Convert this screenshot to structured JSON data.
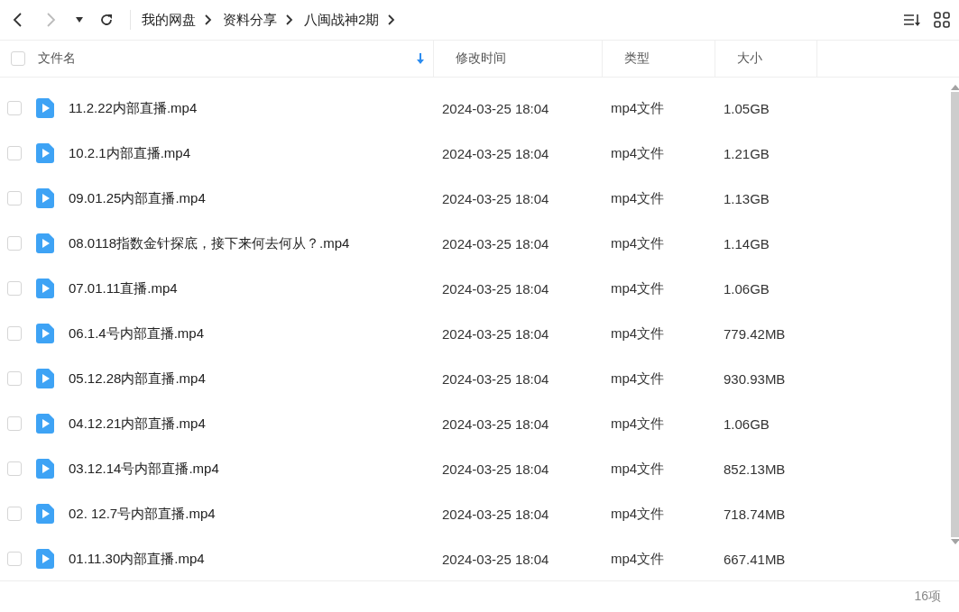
{
  "breadcrumb": [
    "我的网盘",
    "资料分享",
    "八闽战神2期"
  ],
  "table": {
    "columns": [
      "文件名",
      "修改时间",
      "类型",
      "大小"
    ],
    "all_checked": false,
    "rows": [
      {
        "name": "11.2.22内部直播.mp4",
        "modified": "2024-03-25 18:04",
        "type": "mp4文件",
        "size": "1.05GB",
        "checked": false
      },
      {
        "name": "10.2.1内部直播.mp4",
        "modified": "2024-03-25 18:04",
        "type": "mp4文件",
        "size": "1.21GB",
        "checked": false
      },
      {
        "name": "09.01.25内部直播.mp4",
        "modified": "2024-03-25 18:04",
        "type": "mp4文件",
        "size": "1.13GB",
        "checked": false
      },
      {
        "name": "08.0118指数金针探底，接下来何去何从？.mp4",
        "modified": "2024-03-25 18:04",
        "type": "mp4文件",
        "size": "1.14GB",
        "checked": false
      },
      {
        "name": "07.01.11直播.mp4",
        "modified": "2024-03-25 18:04",
        "type": "mp4文件",
        "size": "1.06GB",
        "checked": false
      },
      {
        "name": "06.1.4号内部直播.mp4",
        "modified": "2024-03-25 18:04",
        "type": "mp4文件",
        "size": "779.42MB",
        "checked": false
      },
      {
        "name": "05.12.28内部直播.mp4",
        "modified": "2024-03-25 18:04",
        "type": "mp4文件",
        "size": "930.93MB",
        "checked": false
      },
      {
        "name": "04.12.21内部直播.mp4",
        "modified": "2024-03-25 18:04",
        "type": "mp4文件",
        "size": "1.06GB",
        "checked": false
      },
      {
        "name": "03.12.14号内部直播.mp4",
        "modified": "2024-03-25 18:04",
        "type": "mp4文件",
        "size": "852.13MB",
        "checked": false
      },
      {
        "name": "02. 12.7号内部直播.mp4",
        "modified": "2024-03-25 18:04",
        "type": "mp4文件",
        "size": "718.74MB",
        "checked": false
      },
      {
        "name": "01.11.30内部直播.mp4",
        "modified": "2024-03-25 18:04",
        "type": "mp4文件",
        "size": "667.41MB",
        "checked": false
      }
    ]
  },
  "status_bar": {
    "count": "16项"
  }
}
